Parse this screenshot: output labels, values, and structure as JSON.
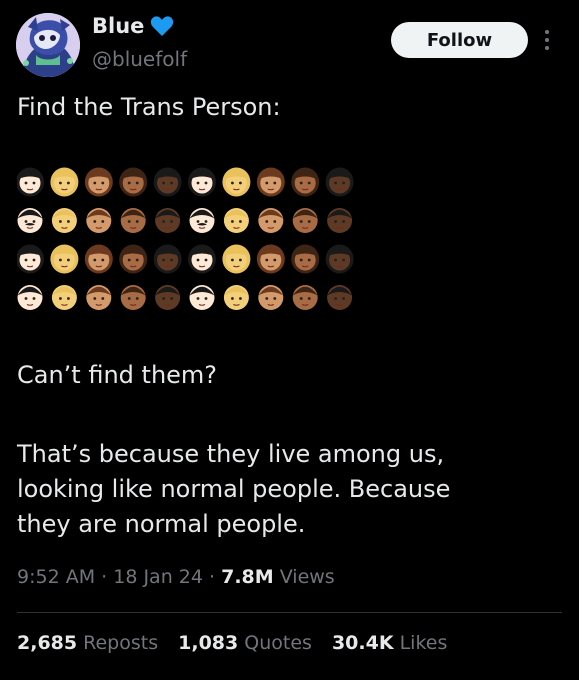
{
  "colors": {
    "background": "#000000",
    "primary_text": "#e7e9ea",
    "secondary_text": "#71767b",
    "follow_bg": "#eff3f4",
    "divider": "#2f3336",
    "heart": "#1d9bf0"
  },
  "user": {
    "display_name": "Blue",
    "badge_icon": "blue-heart-icon",
    "handle": "@bluefolf",
    "avatar_icon": "avatar"
  },
  "header": {
    "follow_label": "Follow",
    "more_icon": "more-vertical-icon"
  },
  "tweet": {
    "line1": "Find the Trans Person:",
    "emoji_grid": {
      "rows": [
        [
          "woman",
          "woman",
          "woman",
          "woman",
          "woman",
          "woman",
          "woman",
          "woman",
          "woman",
          "woman"
        ],
        [
          "man-mustache",
          "man",
          "man",
          "man",
          "man",
          "man-mustache",
          "man",
          "man",
          "man",
          "man"
        ],
        [
          "woman",
          "woman",
          "woman",
          "woman",
          "woman",
          "woman",
          "woman",
          "woman",
          "woman",
          "woman"
        ],
        [
          "man",
          "man",
          "man",
          "man",
          "man",
          "man",
          "man",
          "man",
          "man",
          "man"
        ]
      ],
      "skin_tones": [
        "#fde9d6",
        "#f3cf7a",
        "#d49a6a",
        "#a86b43",
        "#5e3a24",
        "#fde9d6",
        "#f3cf7a",
        "#d49a6a",
        "#a86b43",
        "#5e3a24"
      ]
    },
    "line2": "Can’t find them?",
    "paragraph": [
      "That’s because they live among us,",
      "looking like normal people. Because",
      "they are normal people."
    ]
  },
  "meta": {
    "time": "9:52 AM",
    "sep1": " · ",
    "date": "18 Jan 24",
    "sep2": " · ",
    "views_count": "7.8M",
    "views_label": " Views"
  },
  "stats": {
    "reposts_count": "2,685",
    "reposts_label": " Reposts",
    "quotes_count": "1,083",
    "quotes_label": " Quotes",
    "likes_count": "30.4K",
    "likes_label": " Likes"
  }
}
